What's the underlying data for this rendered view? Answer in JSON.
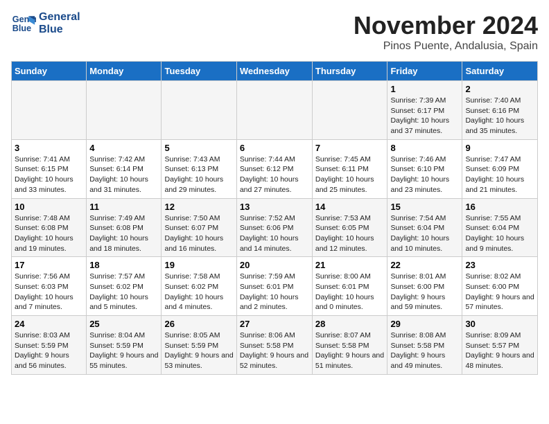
{
  "header": {
    "logo_line1": "General",
    "logo_line2": "Blue",
    "month": "November 2024",
    "location": "Pinos Puente, Andalusia, Spain"
  },
  "weekdays": [
    "Sunday",
    "Monday",
    "Tuesday",
    "Wednesday",
    "Thursday",
    "Friday",
    "Saturday"
  ],
  "weeks": [
    [
      {
        "day": "",
        "info": ""
      },
      {
        "day": "",
        "info": ""
      },
      {
        "day": "",
        "info": ""
      },
      {
        "day": "",
        "info": ""
      },
      {
        "day": "",
        "info": ""
      },
      {
        "day": "1",
        "info": "Sunrise: 7:39 AM\nSunset: 6:17 PM\nDaylight: 10 hours and 37 minutes."
      },
      {
        "day": "2",
        "info": "Sunrise: 7:40 AM\nSunset: 6:16 PM\nDaylight: 10 hours and 35 minutes."
      }
    ],
    [
      {
        "day": "3",
        "info": "Sunrise: 7:41 AM\nSunset: 6:15 PM\nDaylight: 10 hours and 33 minutes."
      },
      {
        "day": "4",
        "info": "Sunrise: 7:42 AM\nSunset: 6:14 PM\nDaylight: 10 hours and 31 minutes."
      },
      {
        "day": "5",
        "info": "Sunrise: 7:43 AM\nSunset: 6:13 PM\nDaylight: 10 hours and 29 minutes."
      },
      {
        "day": "6",
        "info": "Sunrise: 7:44 AM\nSunset: 6:12 PM\nDaylight: 10 hours and 27 minutes."
      },
      {
        "day": "7",
        "info": "Sunrise: 7:45 AM\nSunset: 6:11 PM\nDaylight: 10 hours and 25 minutes."
      },
      {
        "day": "8",
        "info": "Sunrise: 7:46 AM\nSunset: 6:10 PM\nDaylight: 10 hours and 23 minutes."
      },
      {
        "day": "9",
        "info": "Sunrise: 7:47 AM\nSunset: 6:09 PM\nDaylight: 10 hours and 21 minutes."
      }
    ],
    [
      {
        "day": "10",
        "info": "Sunrise: 7:48 AM\nSunset: 6:08 PM\nDaylight: 10 hours and 19 minutes."
      },
      {
        "day": "11",
        "info": "Sunrise: 7:49 AM\nSunset: 6:08 PM\nDaylight: 10 hours and 18 minutes."
      },
      {
        "day": "12",
        "info": "Sunrise: 7:50 AM\nSunset: 6:07 PM\nDaylight: 10 hours and 16 minutes."
      },
      {
        "day": "13",
        "info": "Sunrise: 7:52 AM\nSunset: 6:06 PM\nDaylight: 10 hours and 14 minutes."
      },
      {
        "day": "14",
        "info": "Sunrise: 7:53 AM\nSunset: 6:05 PM\nDaylight: 10 hours and 12 minutes."
      },
      {
        "day": "15",
        "info": "Sunrise: 7:54 AM\nSunset: 6:04 PM\nDaylight: 10 hours and 10 minutes."
      },
      {
        "day": "16",
        "info": "Sunrise: 7:55 AM\nSunset: 6:04 PM\nDaylight: 10 hours and 9 minutes."
      }
    ],
    [
      {
        "day": "17",
        "info": "Sunrise: 7:56 AM\nSunset: 6:03 PM\nDaylight: 10 hours and 7 minutes."
      },
      {
        "day": "18",
        "info": "Sunrise: 7:57 AM\nSunset: 6:02 PM\nDaylight: 10 hours and 5 minutes."
      },
      {
        "day": "19",
        "info": "Sunrise: 7:58 AM\nSunset: 6:02 PM\nDaylight: 10 hours and 4 minutes."
      },
      {
        "day": "20",
        "info": "Sunrise: 7:59 AM\nSunset: 6:01 PM\nDaylight: 10 hours and 2 minutes."
      },
      {
        "day": "21",
        "info": "Sunrise: 8:00 AM\nSunset: 6:01 PM\nDaylight: 10 hours and 0 minutes."
      },
      {
        "day": "22",
        "info": "Sunrise: 8:01 AM\nSunset: 6:00 PM\nDaylight: 9 hours and 59 minutes."
      },
      {
        "day": "23",
        "info": "Sunrise: 8:02 AM\nSunset: 6:00 PM\nDaylight: 9 hours and 57 minutes."
      }
    ],
    [
      {
        "day": "24",
        "info": "Sunrise: 8:03 AM\nSunset: 5:59 PM\nDaylight: 9 hours and 56 minutes."
      },
      {
        "day": "25",
        "info": "Sunrise: 8:04 AM\nSunset: 5:59 PM\nDaylight: 9 hours and 55 minutes."
      },
      {
        "day": "26",
        "info": "Sunrise: 8:05 AM\nSunset: 5:59 PM\nDaylight: 9 hours and 53 minutes."
      },
      {
        "day": "27",
        "info": "Sunrise: 8:06 AM\nSunset: 5:58 PM\nDaylight: 9 hours and 52 minutes."
      },
      {
        "day": "28",
        "info": "Sunrise: 8:07 AM\nSunset: 5:58 PM\nDaylight: 9 hours and 51 minutes."
      },
      {
        "day": "29",
        "info": "Sunrise: 8:08 AM\nSunset: 5:58 PM\nDaylight: 9 hours and 49 minutes."
      },
      {
        "day": "30",
        "info": "Sunrise: 8:09 AM\nSunset: 5:57 PM\nDaylight: 9 hours and 48 minutes."
      }
    ]
  ]
}
